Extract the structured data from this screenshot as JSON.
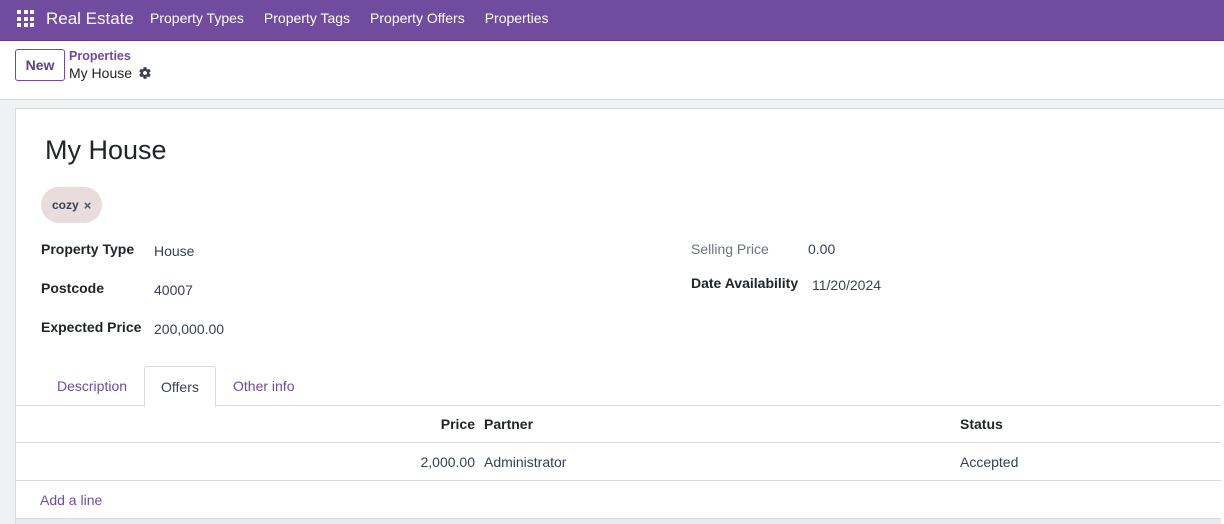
{
  "navbar": {
    "apps_icon": "apps-grid-icon",
    "brand": "Real Estate",
    "menu": [
      "Property Types",
      "Property Tags",
      "Property Offers",
      "Properties"
    ],
    "color": "#714b9e"
  },
  "control_panel": {
    "new_label": "New",
    "breadcrumb_parent": "Properties",
    "breadcrumb_current": "My House",
    "settings_icon": "gear-icon"
  },
  "form": {
    "title": "My House",
    "tags": [
      {
        "label": "cozy",
        "remove_icon": "×"
      }
    ],
    "fields_left": [
      {
        "label": "Property Type",
        "value": "House"
      },
      {
        "label": "Postcode",
        "value": "40007"
      },
      {
        "label": "Expected Price",
        "value": "200,000.00"
      }
    ],
    "fields_right": [
      {
        "label": "Selling Price",
        "value": "0.00"
      },
      {
        "label": "Date Availability",
        "value": "11/20/2024"
      }
    ]
  },
  "tabs": [
    {
      "label": "Description",
      "active": false
    },
    {
      "label": "Offers",
      "active": true
    },
    {
      "label": "Other info",
      "active": false
    }
  ],
  "offers": {
    "columns": [
      "Price",
      "Partner",
      "Status"
    ],
    "rows": [
      {
        "price": "2,000.00",
        "partner": "Administrator",
        "status": "Accepted"
      }
    ],
    "add_line": "Add a line"
  }
}
